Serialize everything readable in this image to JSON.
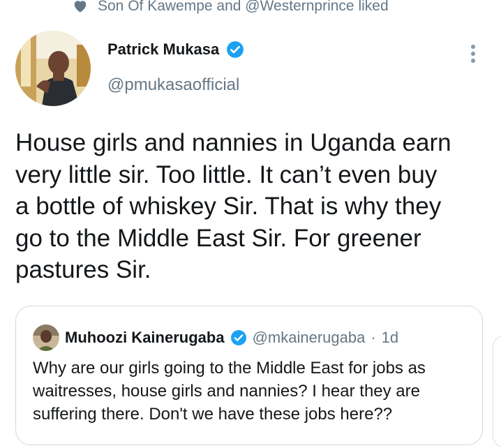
{
  "social_context": {
    "text": "Son Of Kawempe and @Westernprince liked"
  },
  "tweet": {
    "author_name": "Patrick Mukasa",
    "author_handle": "@pmukasaofficial",
    "text": "House girls and nannies in Uganda earn\nvery little sir. Too little. It can’t even buy\na bottle of whiskey Sir. That is why they\ngo to the Middle East Sir. For greener\npastures Sir."
  },
  "quote": {
    "author_name": "Muhoozi Kainerugaba",
    "author_handle": "@mkainerugaba",
    "separator": "·",
    "time": "1d",
    "text": "Why are our girls going to the Middle East for jobs as\nwaitresses, house girls and nannies? I hear they are\nsuffering there. Don't we have these jobs here??"
  },
  "icons": {
    "social_context": "heart-icon",
    "verified": "verified-badge-icon",
    "more": "more-vertical-icon"
  },
  "colors": {
    "text": "#14171a",
    "secondary": "#657786",
    "verified": "#1da1f2",
    "border": "#cfd9de"
  }
}
